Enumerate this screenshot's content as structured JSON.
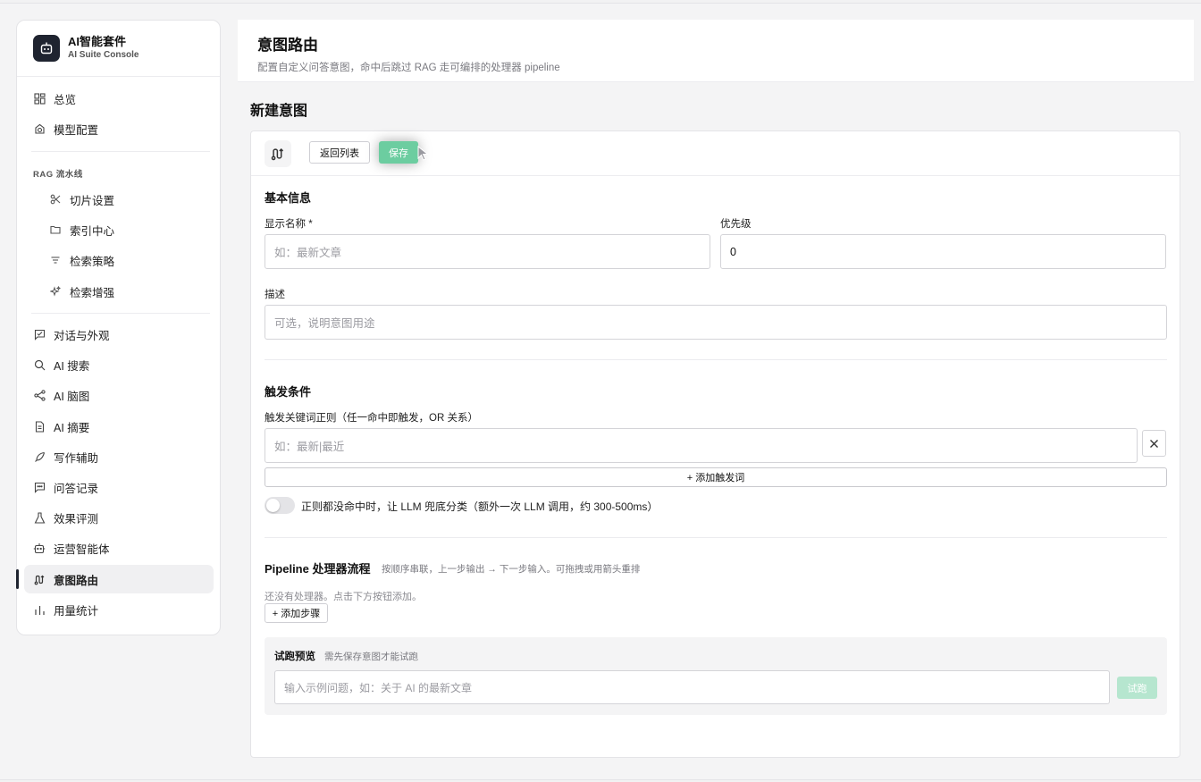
{
  "brand": {
    "title": "AI智能套件",
    "subtitle": "AI Suite Console"
  },
  "sidebar": {
    "items": [
      {
        "label": "总览",
        "icon": "dashboard-icon"
      },
      {
        "label": "模型配置",
        "icon": "model-icon"
      },
      {
        "label": "切片设置",
        "icon": "scissors-icon"
      },
      {
        "label": "索引中心",
        "icon": "folder-icon"
      },
      {
        "label": "检索策略",
        "icon": "filter-icon"
      },
      {
        "label": "检索增强",
        "icon": "sparkles-icon"
      },
      {
        "label": "对话与外观",
        "icon": "chat-appearance-icon"
      },
      {
        "label": "AI 搜索",
        "icon": "search-icon"
      },
      {
        "label": "AI 脑图",
        "icon": "mindmap-icon"
      },
      {
        "label": "AI 摘要",
        "icon": "document-icon"
      },
      {
        "label": "写作辅助",
        "icon": "feather-icon"
      },
      {
        "label": "问答记录",
        "icon": "message-icon"
      },
      {
        "label": "效果评测",
        "icon": "flask-icon"
      },
      {
        "label": "运营智能体",
        "icon": "bot-icon"
      },
      {
        "label": "意图路由",
        "icon": "route-icon",
        "active": true
      },
      {
        "label": "用量统计",
        "icon": "bar-chart-icon"
      }
    ],
    "section_rag": "RAG 流水线"
  },
  "header": {
    "title": "意图路由",
    "description": "配置自定义问答意图，命中后跳过 RAG 走可编排的处理器 pipeline"
  },
  "page": {
    "section_title": "新建意图"
  },
  "toolbar": {
    "back_label": "返回列表",
    "save_label": "保存"
  },
  "basic": {
    "title": "基本信息",
    "name_label": "显示名称 *",
    "name_placeholder": "如：最新文章",
    "priority_label": "优先级",
    "priority_value": "0",
    "desc_label": "描述",
    "desc_placeholder": "可选，说明意图用途"
  },
  "trigger": {
    "title": "触发条件",
    "regex_label": "触发关键词正则（任一命中即触发，OR 关系）",
    "regex_placeholder": "如：最新|最近",
    "add_label": "+ 添加触发词",
    "llm_fallback_label": "正则都没命中时，让 LLM 兜底分类（额外一次 LLM 调用，约 300-500ms）",
    "llm_fallback_on": false
  },
  "pipeline": {
    "title": "Pipeline 处理器流程",
    "hint": "按顺序串联，上一步输出 → 下一步输入。可拖拽或用箭头重排",
    "empty": "还没有处理器。点击下方按钮添加。",
    "add_step_label": "+ 添加步骤"
  },
  "preview": {
    "title": "试跑预览",
    "hint": "需先保存意图才能试跑",
    "input_placeholder": "输入示例问题，如：关于 AI 的最新文章",
    "run_label": "试跑"
  },
  "colors": {
    "accent": "#6ccda0",
    "accent_disabled": "#b6e6cf",
    "brand_dark": "#1f2430"
  }
}
